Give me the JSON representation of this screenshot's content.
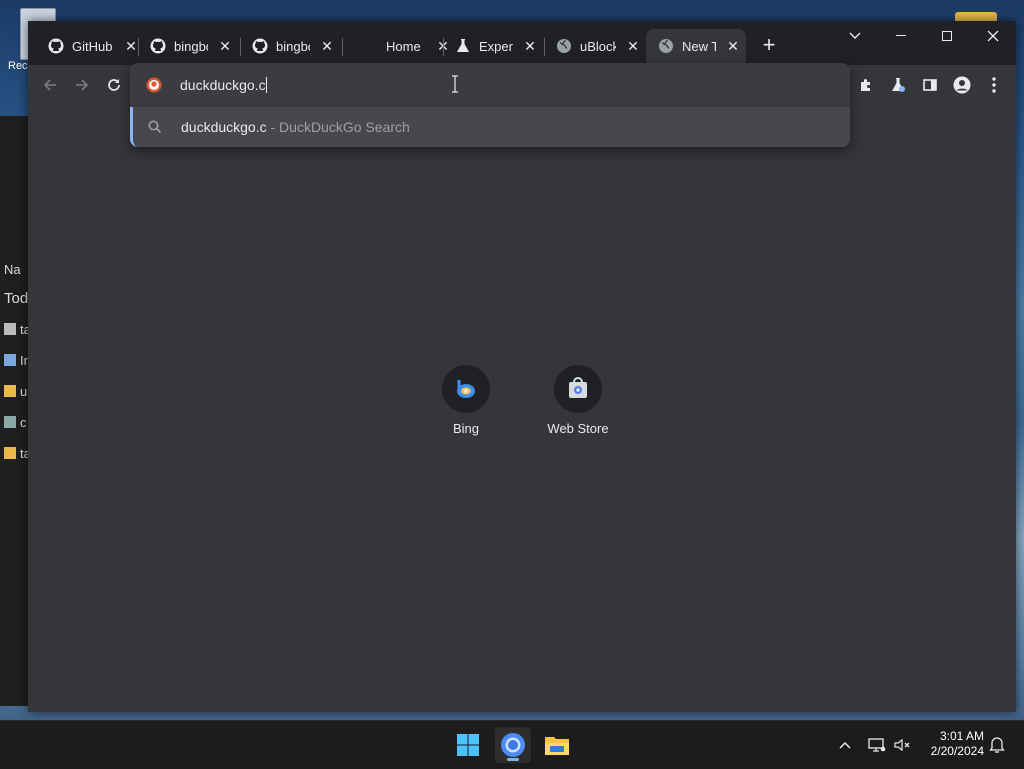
{
  "desktop": {
    "recycle_label": "Rec",
    "explorer_rows": [
      "Na",
      "Tod",
      "ta",
      "In",
      "u",
      "c",
      "ta"
    ]
  },
  "browser": {
    "tabs": [
      {
        "title": "GitHub",
        "icon": "github-icon"
      },
      {
        "title": "bingbot",
        "icon": "github-icon"
      },
      {
        "title": "bingbot",
        "icon": "github-icon"
      },
      {
        "title": "Home",
        "icon": "blank-icon"
      },
      {
        "title": "Experiments",
        "icon": "flask-icon"
      },
      {
        "title": "uBlock",
        "icon": "globe-icon"
      },
      {
        "title": "New Tab",
        "icon": "globe-icon",
        "active": true
      }
    ],
    "omnibox": {
      "value": "duckduckgo.c",
      "suggestion_query": "duckduckgo.c",
      "suggestion_engine": " - DuckDuckGo Search"
    },
    "shortcuts": [
      {
        "label": "Bing"
      },
      {
        "label": "Web Store"
      }
    ]
  },
  "taskbar": {
    "time": "3:01 AM",
    "date": "2/20/2024"
  },
  "colors": {
    "accent": "#8ab4f8",
    "frame": "#202124",
    "content": "#35363a"
  }
}
